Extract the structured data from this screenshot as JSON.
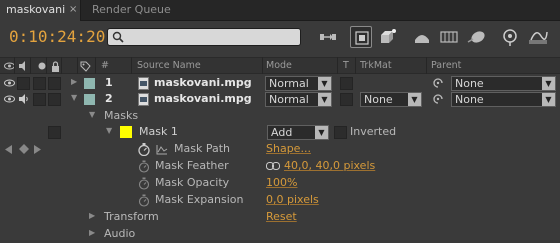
{
  "tabs": [
    {
      "label": "maskovani",
      "close": "×"
    },
    {
      "label": "Render Queue"
    }
  ],
  "timecode": "0:10:24:20",
  "search": {
    "placeholder": ""
  },
  "header": {
    "source_name": "Source Name",
    "mode": "Mode",
    "t": "T",
    "trkmat": "TrkMat",
    "parent": "Parent"
  },
  "layers": [
    {
      "num": "1",
      "name": "maskovani.mpg",
      "mode": "Normal",
      "trkmat": "",
      "parent": "None",
      "label_color": "#8fb7b0"
    },
    {
      "num": "2",
      "name": "maskovani.mpg",
      "mode": "Normal",
      "trkmat": "None",
      "parent": "None",
      "label_color": "#8fb7b0"
    }
  ],
  "masks_group": "Masks",
  "mask": {
    "name": "Mask 1",
    "color": "#ffff00",
    "mode": "Add",
    "inverted_label": "Inverted"
  },
  "mask_props": [
    {
      "name": "Mask Path",
      "value": "Shape..."
    },
    {
      "name": "Mask Feather",
      "value": "40,0, 40,0 pixels"
    },
    {
      "name": "Mask Opacity",
      "value": "100%"
    },
    {
      "name": "Mask Expansion",
      "value": "0,0 pixels"
    }
  ],
  "transform": {
    "label": "Transform",
    "value": "Reset"
  },
  "audio": {
    "label": "Audio"
  },
  "colors": {
    "accent": "#e3a33e",
    "value": "#d69a3a"
  }
}
